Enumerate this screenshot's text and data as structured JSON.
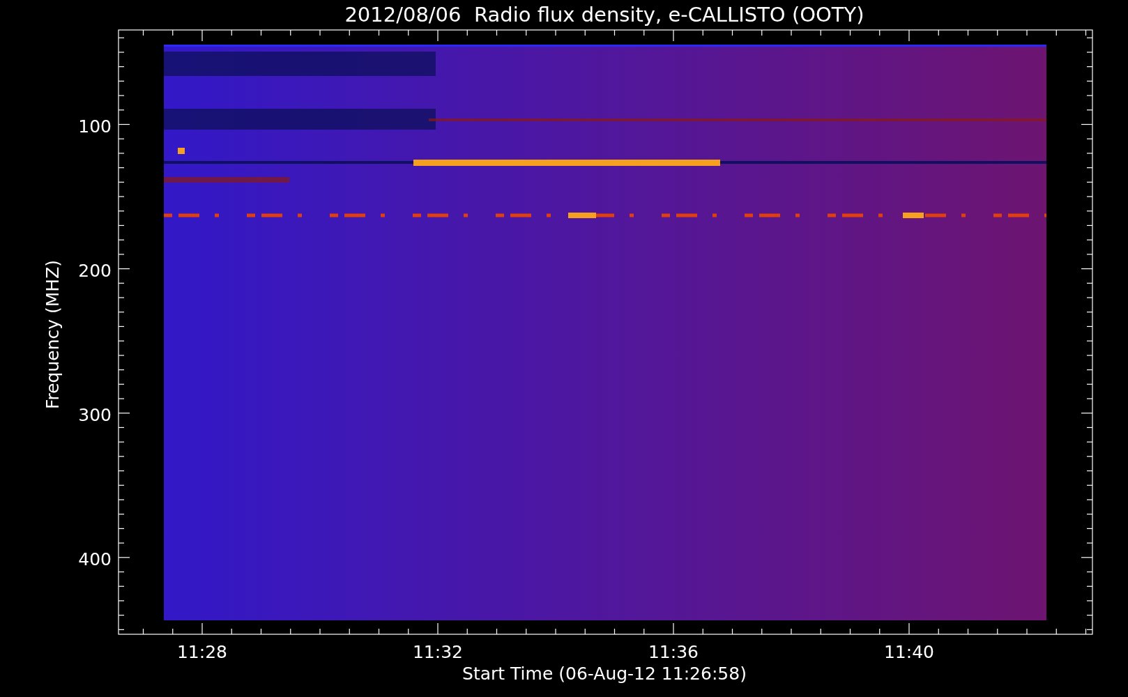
{
  "plot": {
    "title": "2012/08/06  Radio flux density, e-CALLISTO (OOTY)",
    "xlabel": "Start Time (06-Aug-12 11:26:58)",
    "ylabel": "Frequency (MHZ)",
    "xtick_labels": [
      "11:28",
      "11:32",
      "11:36",
      "11:40"
    ],
    "ytick_labels": [
      "100",
      "200",
      "300",
      "400"
    ]
  }
}
